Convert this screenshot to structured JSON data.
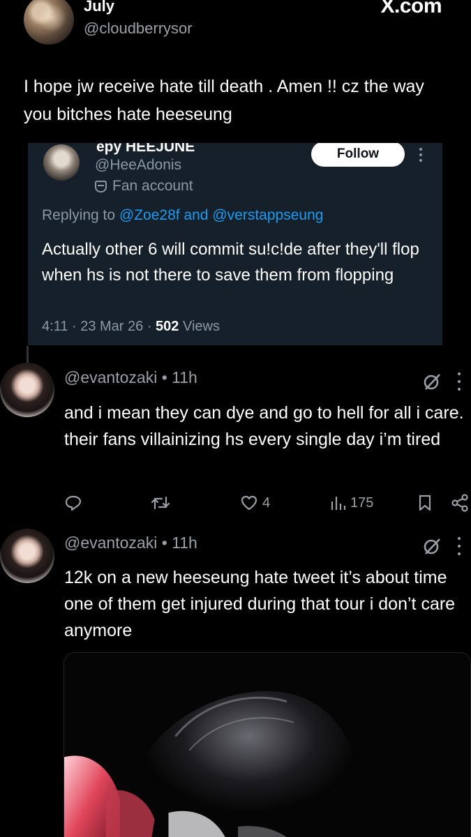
{
  "header": {
    "display_name": "July",
    "handle": "@cloudberrysor",
    "source_logo": "X.com"
  },
  "top_post": {
    "text": "I hope jw receive hate till death . Amen !! cz the way you bitches hate heeseung"
  },
  "embedded_tweet": {
    "display_name": "epy HEEJUNE",
    "handle": "@HeeAdonis",
    "label": "Fan account",
    "follow_label": "Follow",
    "replying_prefix": "Replying to",
    "replying_user_1": "@Zoe28f",
    "replying_and": "and",
    "replying_user_2": "@verstappseung",
    "text": "Actually other 6 will commit su!c!de after they'll flop when hs is not there to save them from flopping",
    "time": "4:11 · 23 Mar 26 ·",
    "views_count": "502",
    "views_label": "Views"
  },
  "replies": [
    {
      "handle_time": "@evantozaki • 11h",
      "text": "and i mean they can dye and go to hell for all i care. their fans villainizing hs every single day i’m tired",
      "likes": "4",
      "views": "175"
    },
    {
      "handle_time": "@evantozaki • 11h",
      "text": "12k on a new heeseung hate tweet it’s about time one of them get injured during that tour i don’t care anymore"
    }
  ],
  "icons": [
    "x-logo",
    "fan-mask-icon",
    "more-icon",
    "grok-icon",
    "reply-icon",
    "retweet-icon",
    "like-icon",
    "views-icon",
    "bookmark-icon",
    "share-icon"
  ],
  "colors": {
    "background": "#000000",
    "embed_background": "#15202b",
    "link": "#1d9bf0",
    "secondary_text": "#9aa0a6"
  }
}
